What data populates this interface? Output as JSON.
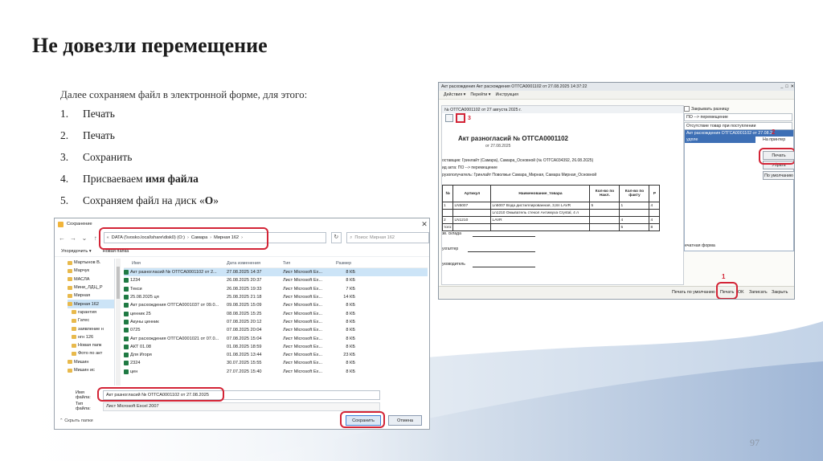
{
  "slide": {
    "title": "Не довезли перемещение",
    "intro": "Далее сохраняем файл в электронной форме, для этого:",
    "steps": [
      {
        "num": "1.",
        "text": "Печать"
      },
      {
        "num": "2.",
        "text": "Печать"
      },
      {
        "num": "3.",
        "text": "Сохранить"
      },
      {
        "num": "4.",
        "prefix": "Присваеваем ",
        "bold": "имя файла",
        "suffix": ""
      },
      {
        "num": "5.",
        "prefix": "Сохраняем файл на диск «",
        "bold": "О",
        "suffix": "»"
      }
    ],
    "page_number": "97"
  },
  "save_dialog": {
    "title": "Сохранение",
    "address": [
      "DATA (\\\\vosko.local\\share\\disk0) (O:)",
      "Самара",
      "Мирная 162"
    ],
    "search_placeholder": "Поиск: Мирная 162",
    "toolbar": {
      "organize": "Упорядочить ▾",
      "new_folder": "Новая папка"
    },
    "tree": [
      {
        "label": "Мартынов В.",
        "sub": false
      },
      {
        "label": "Марчук",
        "sub": false
      },
      {
        "label": "МАСЛА",
        "sub": false
      },
      {
        "label": "Мини_ЛДЦ_Р",
        "sub": false
      },
      {
        "label": "Мирная",
        "sub": false
      },
      {
        "label": "Мирная 162",
        "sub": false,
        "selected": true
      },
      {
        "label": "гарантия",
        "sub": true
      },
      {
        "label": "Гатес",
        "sub": true
      },
      {
        "label": "заявление н",
        "sub": true
      },
      {
        "label": "нгн 126",
        "sub": true
      },
      {
        "label": "Новая папк",
        "sub": true
      },
      {
        "label": "Фото по акт",
        "sub": true
      },
      {
        "label": "Мишин",
        "sub": false
      },
      {
        "label": "Мишин ис",
        "sub": false
      }
    ],
    "columns": {
      "name": "Имя",
      "date": "Дата изменения",
      "type": "Тип",
      "size": "Размер"
    },
    "files": [
      {
        "name": "Акт разногласий № ОТГСА0001102 от 2...",
        "date": "27.08.2025 14:37",
        "type": "Лист Microsoft Ex...",
        "size": "8 КБ",
        "selected": true
      },
      {
        "name": "1234",
        "date": "26.08.2025 20:37",
        "type": "Лист Microsoft Ex...",
        "size": "8 КБ"
      },
      {
        "name": "Текси",
        "date": "26.08.2025 19:33",
        "type": "Лист Microsoft Ex...",
        "size": "7 КБ"
      },
      {
        "name": "25.08.2025 ця",
        "date": "25.08.2025 21:18",
        "type": "Лист Microsoft Ex...",
        "size": "14 КБ"
      },
      {
        "name": "Акт расхождения ОТГСА0001037 от 09.0...",
        "date": "09.08.2025 15:09",
        "type": "Лист Microsoft Ex...",
        "size": "8 КБ"
      },
      {
        "name": "ценник 25",
        "date": "08.08.2025 15:25",
        "type": "Лист Microsoft Ex...",
        "size": "8 КБ"
      },
      {
        "name": "Акуны ценник",
        "date": "07.08.2025 20:12",
        "type": "Лист Microsoft Ex...",
        "size": "8 КБ"
      },
      {
        "name": "0725",
        "date": "07.08.2025 20:04",
        "type": "Лист Microsoft Ex...",
        "size": "8 КБ"
      },
      {
        "name": "Акт расхождения ОТГСА0001021 от 07.0...",
        "date": "07.08.2025 15:04",
        "type": "Лист Microsoft Ex...",
        "size": "8 КБ"
      },
      {
        "name": "АКТ 01.08",
        "date": "01.08.2025 18:59",
        "type": "Лист Microsoft Ex...",
        "size": "8 КБ"
      },
      {
        "name": "Для Игоря",
        "date": "01.08.2025 13:44",
        "type": "Лист Microsoft Ex...",
        "size": "23 КБ"
      },
      {
        "name": "2324",
        "date": "30.07.2025 15:55",
        "type": "Лист Microsoft Ex...",
        "size": "8 КБ"
      },
      {
        "name": "цен",
        "date": "27.07.2025 15:40",
        "type": "Лист Microsoft Ex...",
        "size": "8 КБ"
      },
      {
        "name": "",
        "date": "",
        "type": "",
        "size": ""
      }
    ],
    "filename_label": "Имя файла:",
    "filename_value": "Акт разногласий № ОТГСА0001102 от 27.08.2025",
    "filetype_label": "Тип файла:",
    "filetype_value": "Лист Microsoft Excel 2007",
    "hide_folders": "Скрыть папки",
    "save_button": "Сохранить",
    "cancel_button": "Отмена"
  },
  "onec": {
    "title": "Акт расхождения  Акт расхождения ОТГСА0001102 от 27.08.2025 14:37:22",
    "menu": [
      "Действия ▾",
      "Перейти ▾",
      "Инструкция"
    ],
    "doc_tab": "№ ОТГСА0001102 от 27 августа 2025 г.",
    "marker_3": "3",
    "act_title": "Акт разногласий № ОТГСА0001102",
    "act_date": "от 27.08.2025",
    "lines": [
      "оставщик: Гринлайт (Самара), Самара_Основной (№ ОТГСА034392, 26.08.2025)",
      "ид акта: ПО --> перемещение",
      "рузополучатель: Гринлайт Поволжье Самара_Мирная, Самара Мирная_Основной"
    ],
    "table_head": [
      "№",
      "Артикул",
      "Наименование_товара",
      "Кол-во по Накл.",
      "Кол-во по факту",
      "Р"
    ],
    "table_rows": [
      [
        "1",
        "LN5007",
        "Ln5007 Вода дистиллированная, 3,8л LAVR",
        "5",
        "1",
        "4"
      ],
      [
        "",
        "",
        "Ln1210 Омыватель стекол Антимуха Crystal, 4 л",
        "",
        "",
        ""
      ],
      [
        "2",
        "LN1210",
        "LAVR",
        "",
        "4",
        "4"
      ],
      [
        "того:",
        "",
        "",
        "",
        "5",
        "8"
      ]
    ],
    "sign_labels": [
      "зв. склада",
      "ухгалтер",
      "уководитель"
    ],
    "right": {
      "chk1": "Закрывать разницу",
      "field1": "ПО --> перемещение",
      "field2": "Отсутствие товар при поступлении",
      "panel_head": "Акт расхождения ОТГСА0001102 от 27.08.2",
      "panel_selected": "удпле",
      "print_on_printer": "На принтер",
      "marker_2": "2",
      "btn_print": "Печать",
      "btn_edit": "Убрать",
      "btn_default": "По умолчанию",
      "footer": "ечатная форма"
    },
    "marker_1": "1",
    "status": {
      "default_print": "Печать по умолчанию",
      "print": "Печать",
      "ok": "OK",
      "save": "Записать",
      "close": "Закрыть"
    }
  }
}
